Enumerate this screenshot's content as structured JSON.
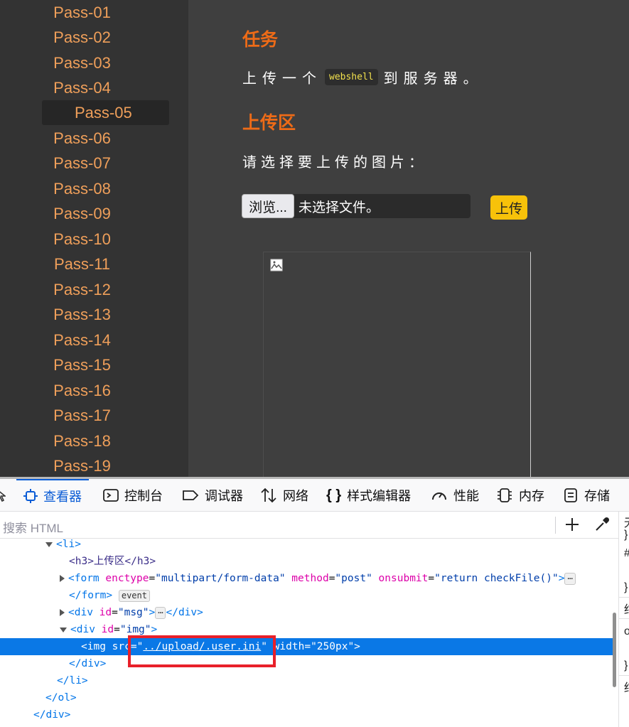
{
  "sidebar": {
    "items": [
      "Pass-01",
      "Pass-02",
      "Pass-03",
      "Pass-04",
      "Pass-05",
      "Pass-06",
      "Pass-07",
      "Pass-08",
      "Pass-09",
      "Pass-10",
      "Pass-11",
      "Pass-12",
      "Pass-13",
      "Pass-14",
      "Pass-15",
      "Pass-16",
      "Pass-17",
      "Pass-18",
      "Pass-19"
    ],
    "active": "Pass-05"
  },
  "main": {
    "task_heading": "任务",
    "task_before": "上传一个",
    "task_code": "webshell",
    "task_after": "到服务器。",
    "upload_heading": "上传区",
    "choose_prompt": "请选择要上传的图片：",
    "browse_label": "浏览...",
    "no_file_label": "未选择文件。",
    "upload_button": "上传"
  },
  "devtools": {
    "tabs": [
      "查看器",
      "控制台",
      "调试器",
      "网络",
      "样式编辑器",
      "性能",
      "内存",
      "存储"
    ],
    "selected_tab": "查看器",
    "search_placeholder": "搜索 HTML",
    "side_chars": [
      "无",
      "}",
      "#",
      "}",
      "结",
      "o",
      "}",
      "结"
    ],
    "tree": {
      "li_open": "<li>",
      "h3_line": "<h3>上传区</h3>",
      "form_tag": "<form",
      "form_attr1": "enctype",
      "form_val1": "\"multipart/form-data\"",
      "form_attr2": "method",
      "form_val2": "\"post\"",
      "form_attr3": "onsubmit",
      "form_val3": "\"return checkFile()\"",
      "form_gt": ">",
      "form_close": "</form>",
      "event_badge": "event",
      "ellipsis": "⋯",
      "div_msg_tag": "<div",
      "div_msg_attr": "id",
      "div_msg_val": "\"msg\"",
      "div_close": "</div>",
      "div_img_tag": "<div",
      "div_img_attr": "id",
      "div_img_val": "\"img\"",
      "img_tag": "<img",
      "img_attr1": "src",
      "img_val1_q": "\"",
      "img_val1_link": "../upload/.user.ini",
      "img_attr2": "width",
      "img_val2": "\"250px\"",
      "li_close": "</li>",
      "ol_close": "</ol>"
    }
  },
  "colors": {
    "accent_orange": "#ee6b17",
    "sidebar_text": "#ef9f5a",
    "upload_yellow": "#f7c20a",
    "devtools_blue": "#0a5cd6",
    "highlight_red": "#e8202a"
  }
}
